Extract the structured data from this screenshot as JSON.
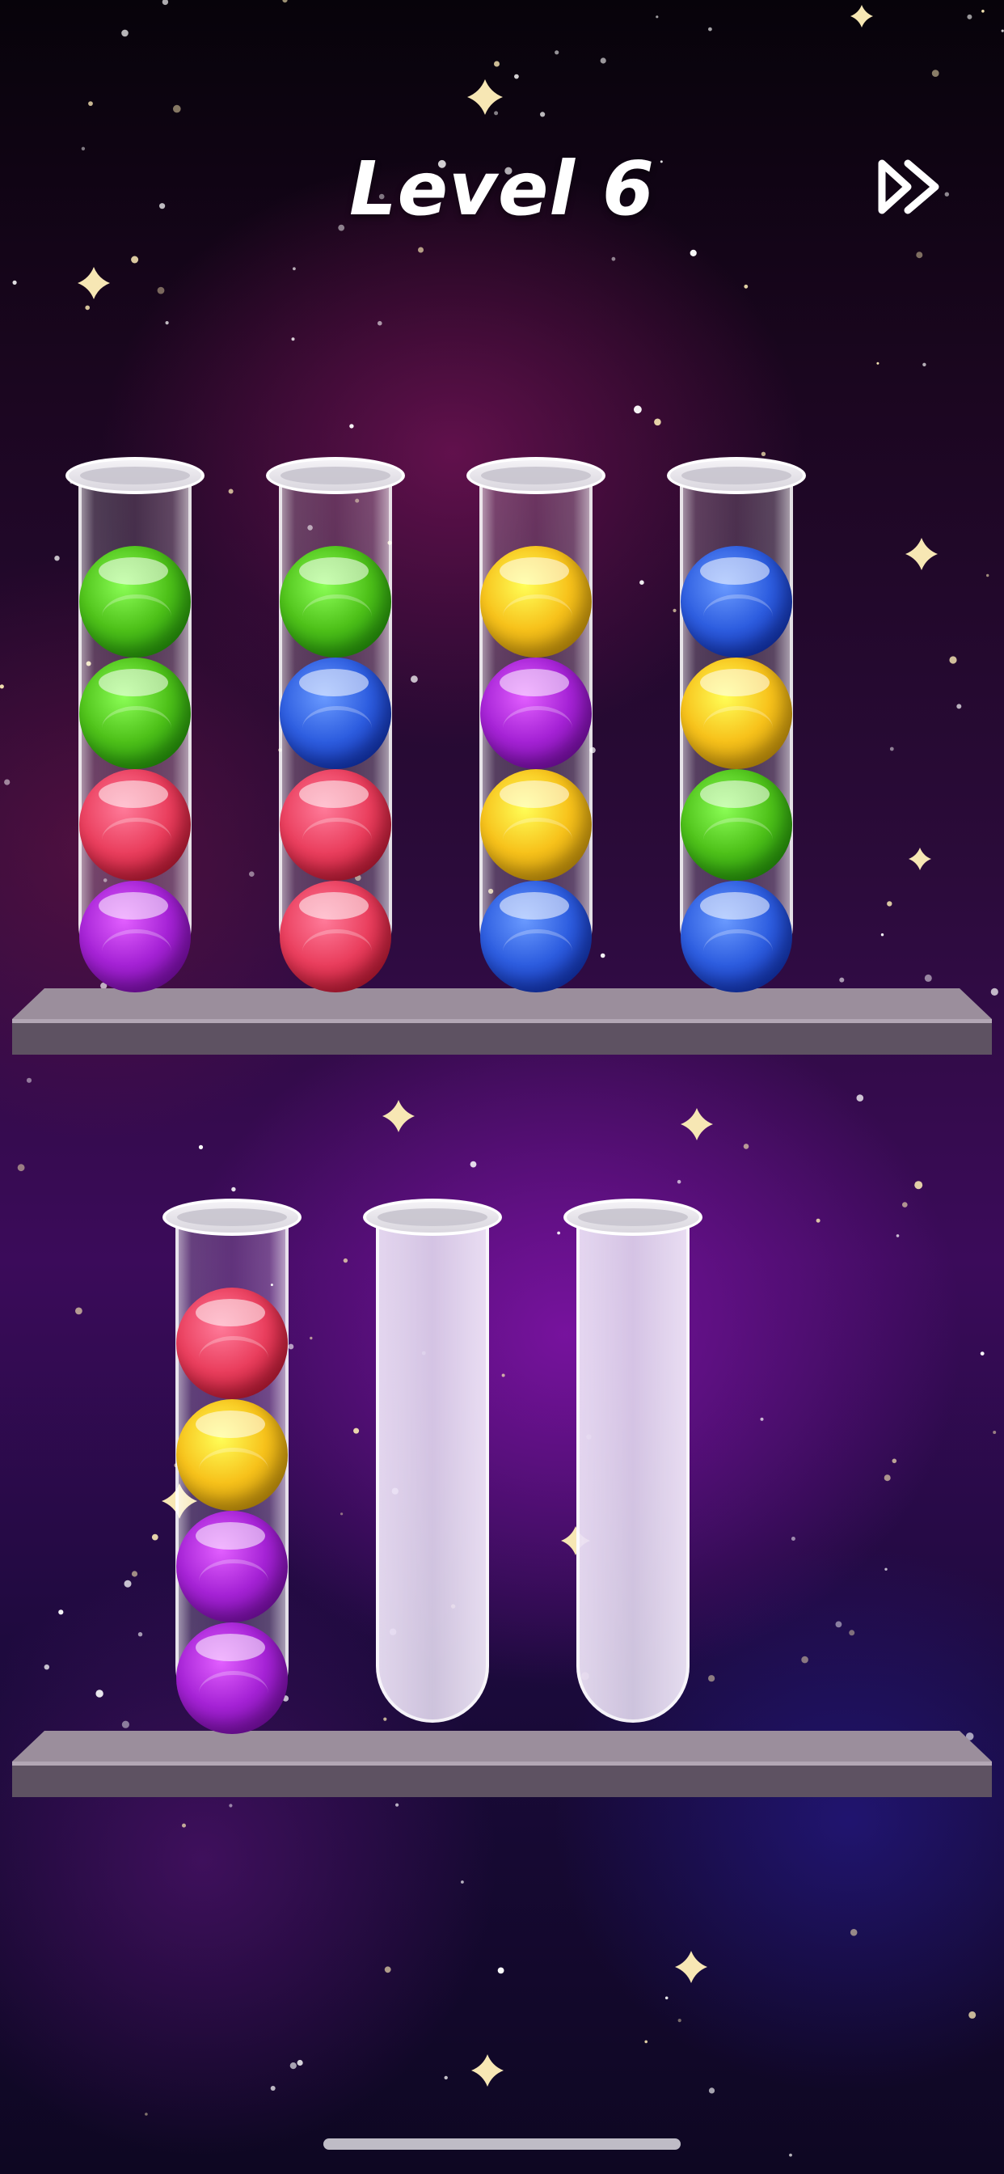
{
  "header": {
    "title": "Level 6",
    "skip_icon": "fast-forward-icon"
  },
  "colors": {
    "green": "#4fc21a",
    "blue": "#2e5ee0",
    "red": "#ea3f5e",
    "purple": "#a623d6",
    "yellow": "#f7c21b"
  },
  "shelves": [
    {
      "tubes": [
        {
          "balls": [
            "green",
            "green",
            "red",
            "purple"
          ]
        },
        {
          "balls": [
            "green",
            "blue",
            "red",
            "red"
          ]
        },
        {
          "balls": [
            "yellow",
            "purple",
            "yellow",
            "blue"
          ]
        },
        {
          "balls": [
            "blue",
            "yellow",
            "green",
            "blue"
          ]
        }
      ]
    },
    {
      "tubes": [
        {
          "balls": [
            "red",
            "yellow",
            "purple",
            "purple"
          ]
        },
        {
          "balls": []
        },
        {
          "balls": []
        }
      ]
    }
  ]
}
